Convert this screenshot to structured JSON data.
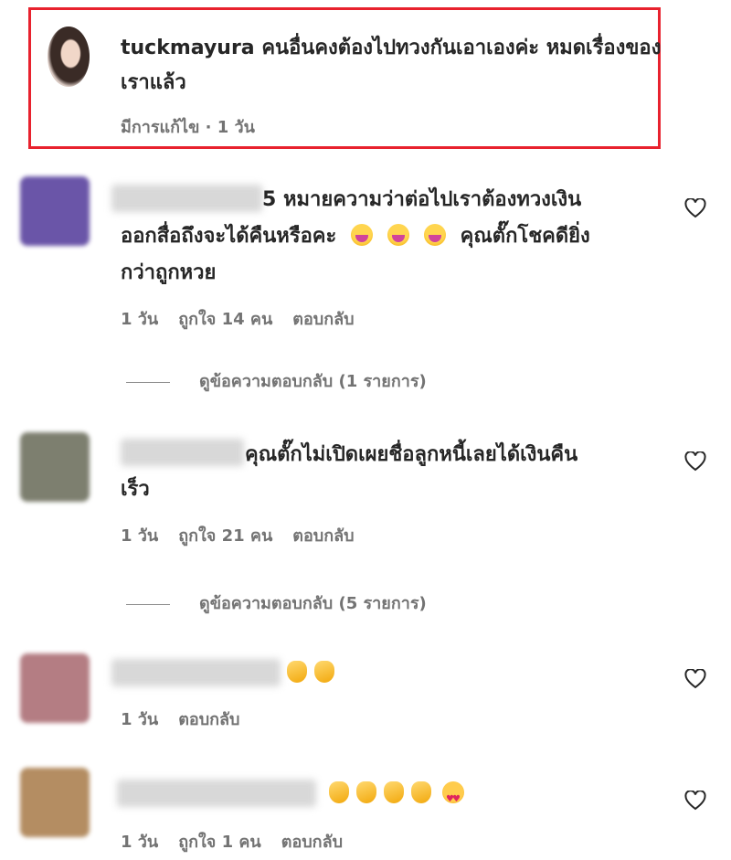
{
  "highlighted_comment": {
    "username": "tuckmayura",
    "text": " คนอื่นคงต้องไปทวงกันเอาเองค่ะ หมดเรื่องของเราแล้ว",
    "meta": "มีการแก้ไข · 1 วัน"
  },
  "comments": [
    {
      "name_suffix": "5",
      "line1": " หมายความว่าต่อไปเราต้องทวงเงิน",
      "line2_before": "ออกสื่อถึงจะได้คืนหรือคะ",
      "line2_after": "คุณตั๊กโชคดียิ่ง",
      "line3": "กว่าถูกหวย",
      "time": "1 วัน",
      "likes": "ถูกใจ 14 คน",
      "reply": "ตอบกลับ",
      "view_replies": "ดูข้อความตอบกลับ (1 รายการ)",
      "emojis": [
        "grinning-face",
        "grinning-face",
        "grinning-face"
      ]
    },
    {
      "line1": "คุณตั๊กไม่เปิดเผยชื่อลูกหนี้เลยได้เงินคืน",
      "line2": "เร็ว",
      "time": "1 วัน",
      "likes": "ถูกใจ 21 คน",
      "reply": "ตอบกลับ",
      "view_replies": "ดูข้อความตอบกลับ (5 รายการ)"
    },
    {
      "time": "1 วัน",
      "reply": "ตอบกลับ",
      "emojis": [
        "clapping-hands",
        "clapping-hands"
      ]
    },
    {
      "time": "1 วัน",
      "likes": "ถูกใจ 1 คน",
      "reply": "ตอบกลับ",
      "emojis": [
        "clapping-hands",
        "clapping-hands",
        "clapping-hands",
        "clapping-hands",
        "heart-eyes-face"
      ]
    }
  ],
  "colors": {
    "highlight_border": "#e8222e",
    "text": "#262626",
    "meta": "#737373"
  },
  "icons": {
    "like": "heart-outline-icon"
  }
}
